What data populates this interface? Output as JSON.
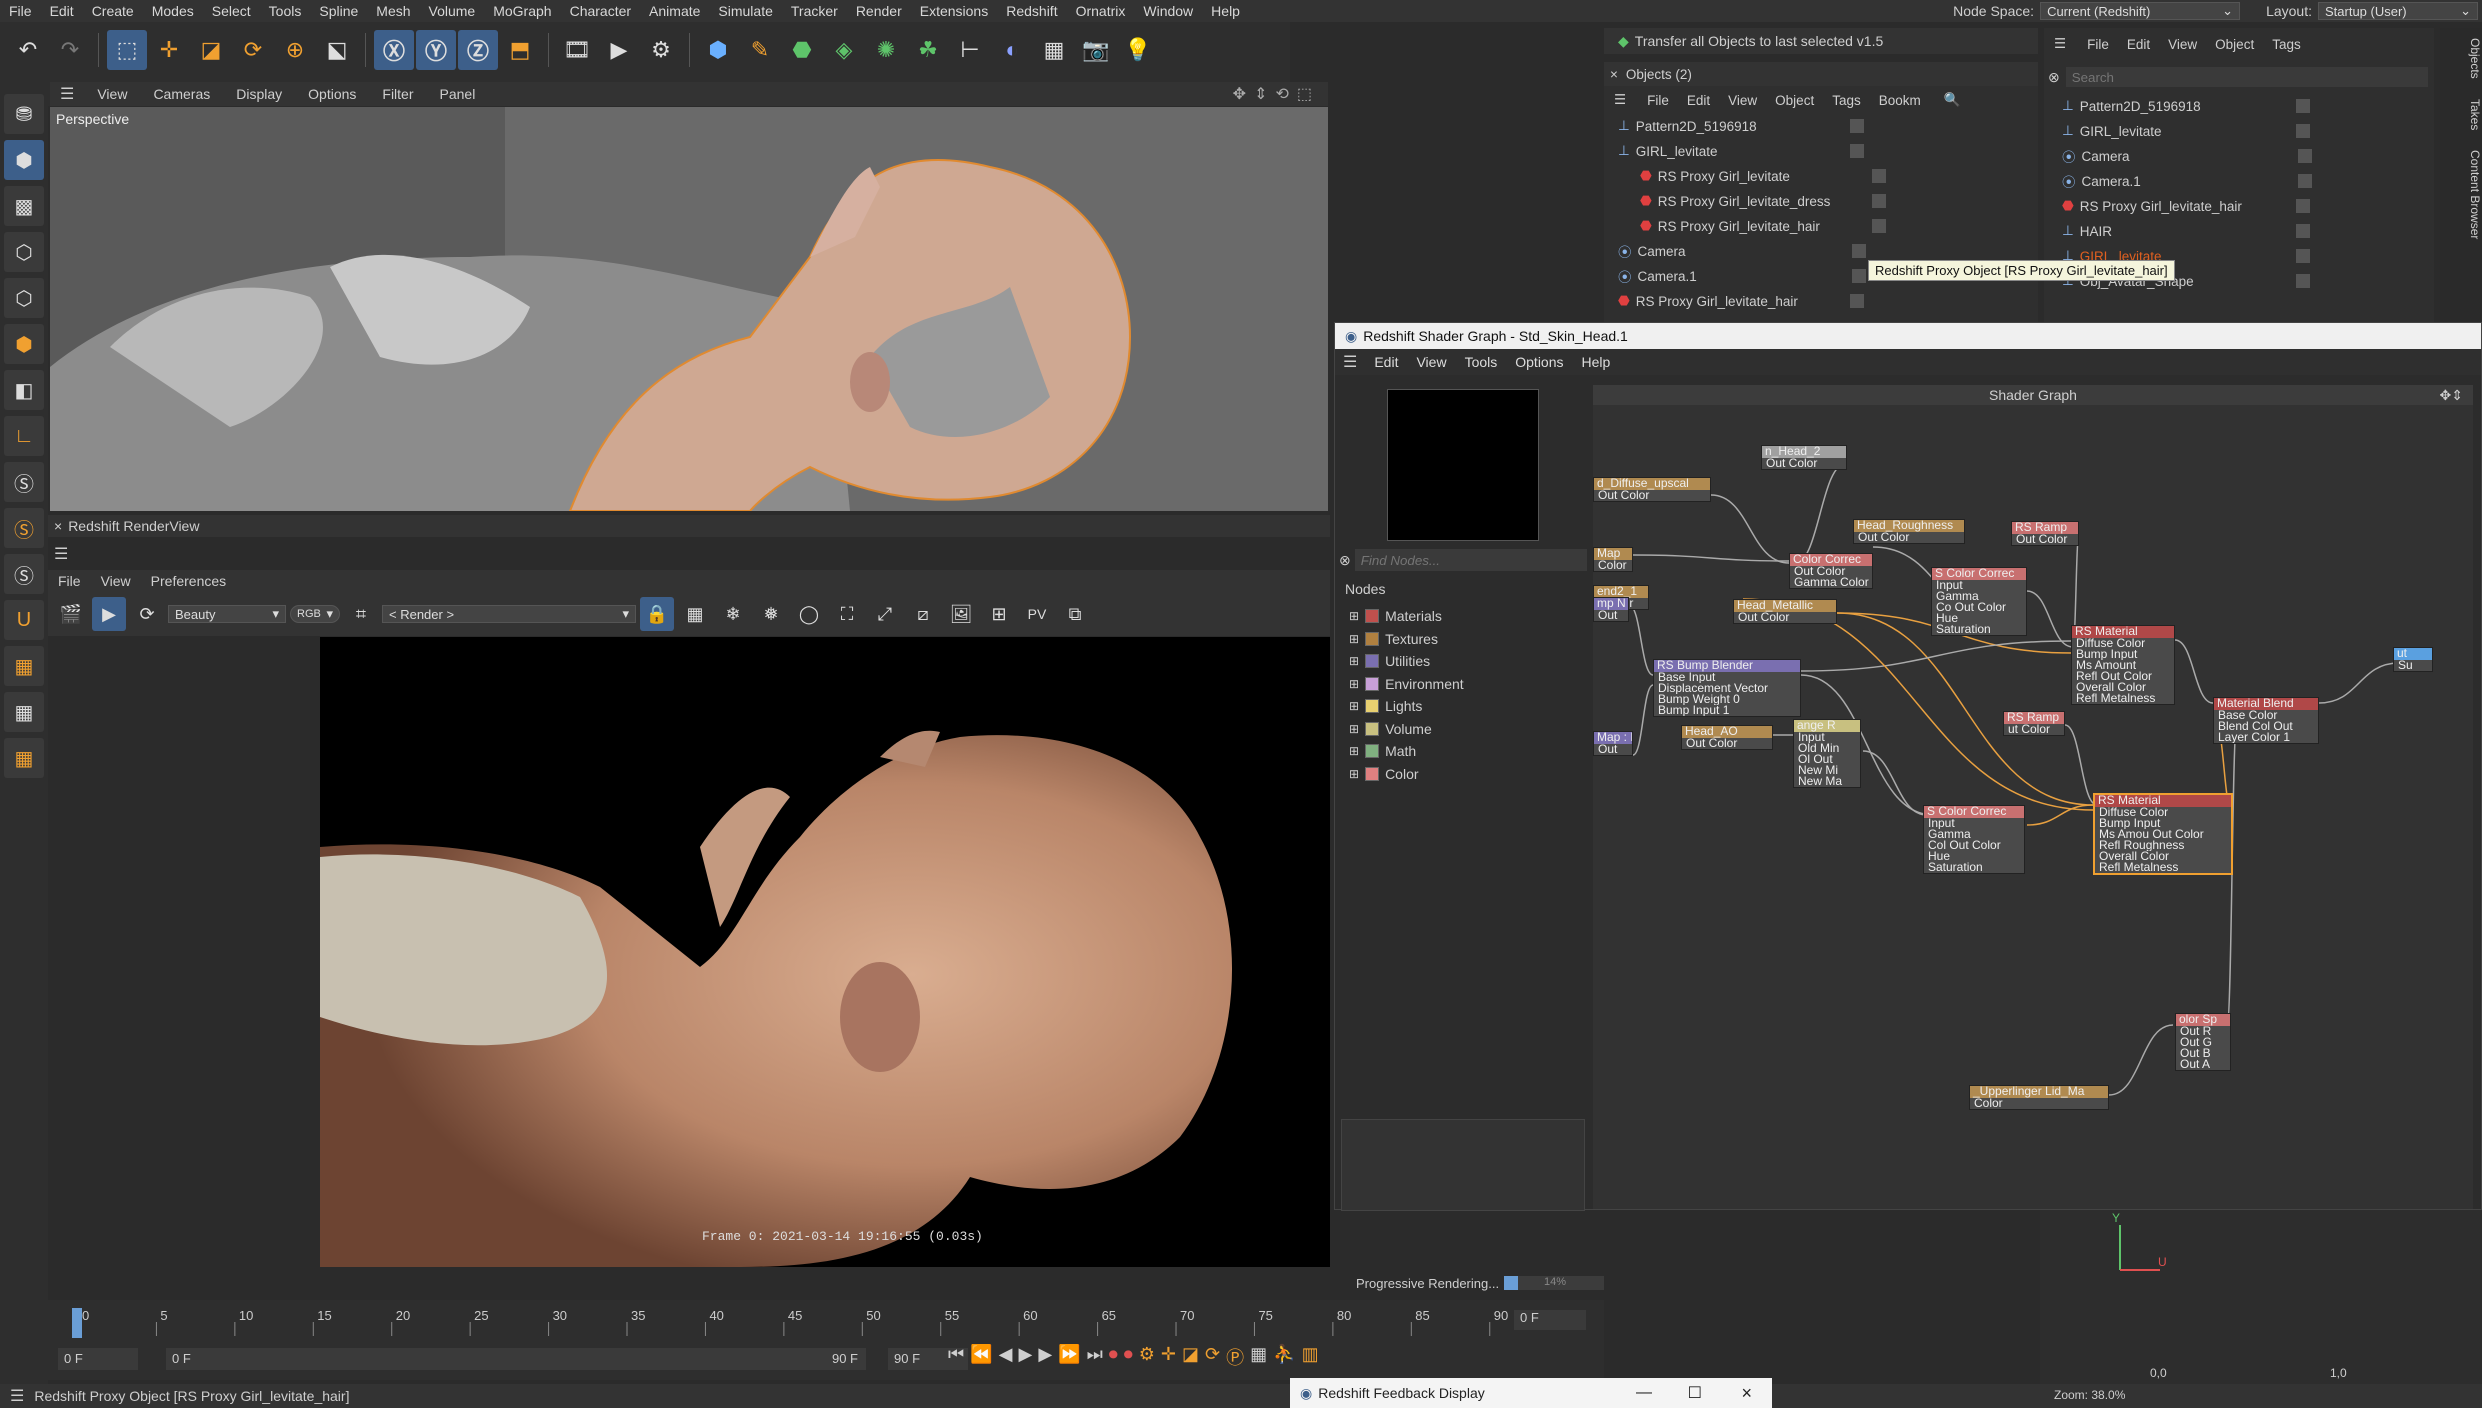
{
  "menubar": {
    "items": [
      "File",
      "Edit",
      "Create",
      "Modes",
      "Select",
      "Tools",
      "Spline",
      "Mesh",
      "Volume",
      "MoGraph",
      "Character",
      "Animate",
      "Simulate",
      "Tracker",
      "Render",
      "Extensions",
      "Redshift",
      "Ornatrix",
      "Window",
      "Help"
    ],
    "node_space_label": "Node Space:",
    "node_space_value": "Current (Redshift)",
    "layout_label": "Layout:",
    "layout_value": "Startup (User)"
  },
  "viewport": {
    "menu": [
      "View",
      "Cameras",
      "Display",
      "Options",
      "Filter",
      "Panel"
    ],
    "label": "Perspective"
  },
  "renderview": {
    "title": "Redshift RenderView",
    "menu": [
      "File",
      "View",
      "Preferences"
    ],
    "aov": "Beauty",
    "rgb": "RGB",
    "camera": "< Render >",
    "frame_info": "Frame  0:  2021-03-14  19:16:55  (0.03s)",
    "progress_label": "Progressive Rendering...",
    "progress_value": "14%",
    "progress_fraction": 0.14
  },
  "transfer_bar": {
    "label": "Transfer all Objects to last selected v1.5"
  },
  "objects_panel": {
    "title": "Objects (2)",
    "menu": [
      "File",
      "Edit",
      "View",
      "Object",
      "Tags",
      "Bookm"
    ],
    "rows": [
      {
        "name": "Pattern2D_5196918",
        "indent": 0
      },
      {
        "name": "GIRL_levitate",
        "indent": 0
      },
      {
        "name": "RS Proxy Girl_levitate",
        "indent": 1
      },
      {
        "name": "RS Proxy Girl_levitate_dress",
        "indent": 1
      },
      {
        "name": "RS Proxy Girl_levitate_hair",
        "indent": 1
      },
      {
        "name": "Camera",
        "indent": 0
      },
      {
        "name": "Camera.1",
        "indent": 0
      },
      {
        "name": "RS Proxy Girl_levitate_hair",
        "indent": 0
      }
    ],
    "tooltip": "Redshift Proxy Object [RS Proxy Girl_levitate_hair]"
  },
  "objects_panel2": {
    "menu": [
      "File",
      "Edit",
      "View",
      "Object",
      "Tags"
    ],
    "search_placeholder": "Search",
    "rows": [
      "Pattern2D_5196918",
      "GIRL_levitate",
      "Camera",
      "Camera.1",
      "RS Proxy Girl_levitate_hair",
      "HAIR",
      "GIRL_levitate",
      "Obj_Avatar_Shape"
    ],
    "side_tabs": [
      "Objects",
      "Takes",
      "Content Browser"
    ],
    "axis_x": "0,0",
    "axis_y": "1,0",
    "zoom": "Zoom: 38.0%"
  },
  "shader_graph": {
    "title": "Redshift Shader Graph - Std_Skin_Head.1",
    "menu": [
      "Edit",
      "View",
      "Tools",
      "Options",
      "Help"
    ],
    "find_placeholder": "Find Nodes...",
    "nodes_header": "Nodes",
    "graph_header": "Shader Graph",
    "categories": [
      {
        "name": "Materials",
        "color": "#c0504d"
      },
      {
        "name": "Textures",
        "color": "#b08040"
      },
      {
        "name": "Utilities",
        "color": "#7a6fb0"
      },
      {
        "name": "Environment",
        "color": "#c8a0d8"
      },
      {
        "name": "Lights",
        "color": "#e8d070"
      },
      {
        "name": "Volume",
        "color": "#c8c080"
      },
      {
        "name": "Math",
        "color": "#80b080"
      },
      {
        "name": "Color",
        "color": "#e08080"
      }
    ],
    "nodes": [
      {
        "title": "n_Head_2",
        "ports": [
          "Out Color"
        ]
      },
      {
        "title": "d_Diffuse_upscal",
        "ports": [
          "Out Color"
        ]
      },
      {
        "title": "Map",
        "ports": [
          "Color"
        ]
      },
      {
        "title": "end2_1",
        "ports": [
          "t Color"
        ]
      },
      {
        "title": "Head_Roughness",
        "ports": [
          "Out Color"
        ]
      },
      {
        "title": "RS Ramp",
        "ports": [
          "Out Color"
        ]
      },
      {
        "title": "Color Correc",
        "ports": [
          "Out Color",
          "Gamma Color"
        ]
      },
      {
        "title": "S Color Correc",
        "ports": [
          "Input",
          "Gamma",
          "Co Out Color",
          "Hue",
          "Saturation"
        ]
      },
      {
        "title": "Head_Metallic",
        "ports": [
          "Out Color"
        ]
      },
      {
        "title": "mp N",
        "ports": [
          "Out"
        ]
      },
      {
        "title": "RS Material",
        "ports": [
          "Diffuse Color",
          "Bump Input",
          "Ms Amount",
          "Refl Out Color",
          "Overall Color",
          "Refl Metalness"
        ]
      },
      {
        "title": "RS Bump Blender",
        "ports": [
          "Base Input",
          "Displacement Vector",
          "Bump Weight 0",
          "Bump Input 1"
        ]
      },
      {
        "title": "RS Ramp",
        "ports": [
          "ut Color"
        ]
      },
      {
        "title": "Material Blend",
        "ports": [
          "Base Color",
          "Blend Col Out",
          "Layer Color 1"
        ]
      },
      {
        "title": "ut",
        "ports": [
          "Su"
        ]
      },
      {
        "title": "Map : Bu",
        "ports": [
          "Out"
        ]
      },
      {
        "title": "Head_AO",
        "ports": [
          "Out Color"
        ]
      },
      {
        "title": "ange R",
        "ports": [
          "Input",
          "Old Min",
          "Ol Out",
          "New Mi",
          "New Ma"
        ]
      },
      {
        "title": "S Color Correc",
        "ports": [
          "Input",
          "Gamma",
          "Col Out Color",
          "Hue",
          "Saturation"
        ]
      },
      {
        "title": "RS Material",
        "ports": [
          "Diffuse Color",
          "Bump Input",
          "Ms Amou Out Color",
          "Refl Roughness",
          "Overall Color",
          "Refl Metalness"
        ]
      },
      {
        "title": "olor Sp",
        "ports": [
          "Out R",
          "Out G",
          "Out B",
          "Out A"
        ]
      },
      {
        "title": "_Upperlinger Lid_Ma",
        "ports": [
          "Color"
        ]
      }
    ]
  },
  "timeline": {
    "ticks": [
      "0",
      "5",
      "10",
      "15",
      "20",
      "25",
      "30",
      "35",
      "40",
      "45",
      "50",
      "55",
      "60",
      "65",
      "70",
      "75",
      "80",
      "85",
      "90"
    ],
    "current_frame": "0 F",
    "start_field": "0 F",
    "min_field": "0 F",
    "end_field": "90 F",
    "max_field": "90 F"
  },
  "status": {
    "text": "Redshift Proxy Object [RS Proxy Girl_levitate_hair]"
  },
  "feedback_window": {
    "title": "Redshift Feedback Display"
  },
  "colors": {
    "accent_blue": "#3d5f8a",
    "selection_orange": "#f0a030",
    "node_header_red": "#b04848"
  }
}
